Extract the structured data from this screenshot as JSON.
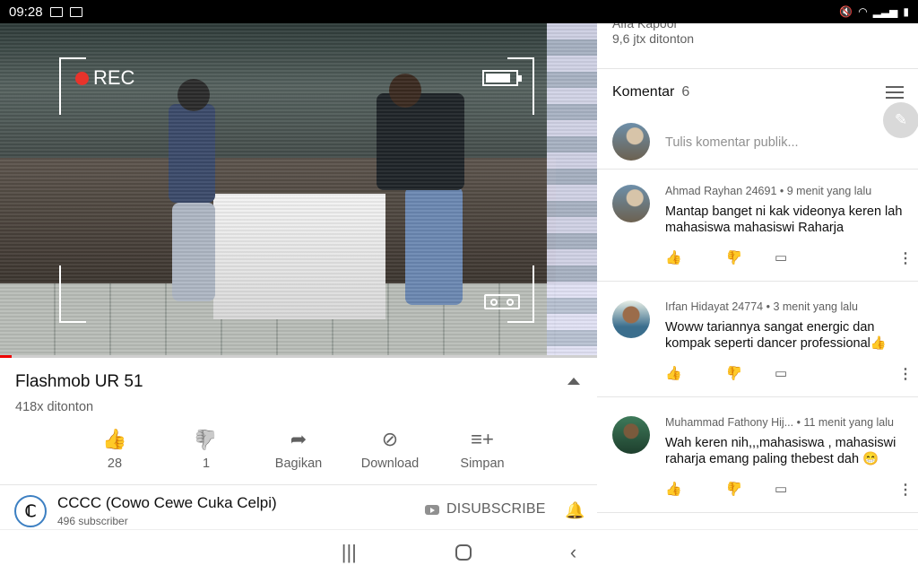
{
  "status_bar": {
    "time": "09:28"
  },
  "player": {
    "rec_label": "REC",
    "battery_level": 0.85,
    "progress": 0.02,
    "colors": {
      "progress": "#ee0000",
      "rec_dot": "#e8332b"
    }
  },
  "video": {
    "title": "Flashmob UR 51",
    "views": "418x ditonton",
    "like_count": "28",
    "dislike_count": "1",
    "share_label": "Bagikan",
    "download_label": "Download",
    "save_label": "Simpan",
    "like_color": "#3a72d6"
  },
  "channel": {
    "name": "CCCC (Cowo Cewe Cuka Celpi)",
    "subscribers": "496 subscriber",
    "subscribe_label": "DISUBSCRIBE"
  },
  "sidebar": {
    "prev_author": "Alfa Kapoor",
    "prev_views": "9,6 jtx ditonton"
  },
  "comments": {
    "header": "Komentar",
    "count": "6",
    "input_placeholder": "Tulis komentar publik...",
    "items": [
      {
        "author": "Ahmad Rayhan 24691",
        "time": "9 menit yang lalu",
        "text": "Mantap banget ni kak videonya keren lah mahasiswa mahasiswi Raharja"
      },
      {
        "author": "Irfan Hidayat 24774",
        "time": "3 menit yang lalu",
        "text": "Woww tariannya sangat energic dan kompak seperti dancer professional👍"
      },
      {
        "author": "Muhammad Fathony Hij...",
        "time": "11 menit yang lalu",
        "text": "Wah keren nih,,,mahasiswa , mahasiswi raharja emang paling thebest dah 😁"
      }
    ]
  }
}
